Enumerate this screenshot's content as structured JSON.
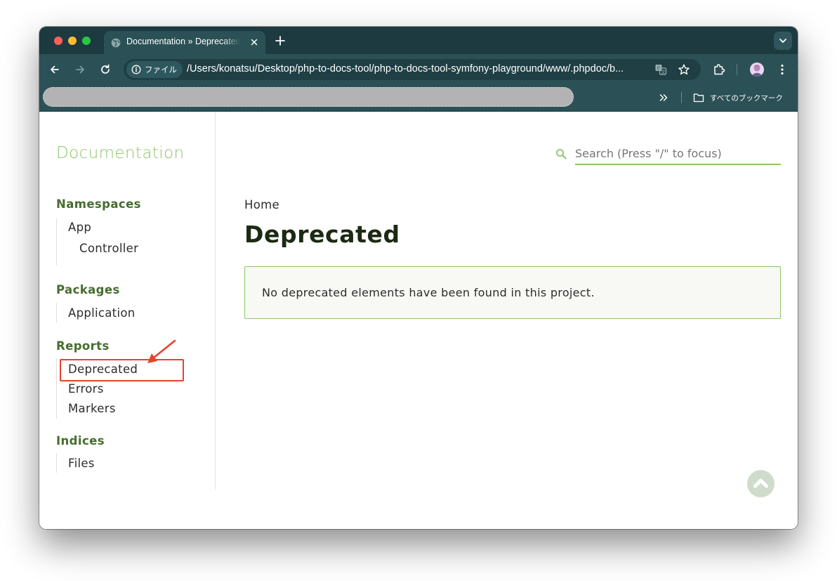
{
  "browser": {
    "tab": {
      "title": "Documentation » Deprecated",
      "favicon": "globe-icon"
    },
    "toolbar": {
      "chip_label": "ファイル",
      "url": "/Users/konatsu/Desktop/php-to-docs-tool/php-to-docs-tool-symfony-playground/www/.phpdoc/b..."
    },
    "bookmarks": {
      "folder_label": "すべてのブックマーク"
    }
  },
  "page": {
    "brand": "Documentation",
    "search_placeholder": "Search (Press \"/\" to focus)",
    "sidebar": {
      "namespaces": {
        "title": "Namespaces",
        "items": [
          "App",
          "Controller"
        ]
      },
      "packages": {
        "title": "Packages",
        "items": [
          "Application"
        ]
      },
      "reports": {
        "title": "Reports",
        "items": [
          "Deprecated",
          "Errors",
          "Markers"
        ]
      },
      "indices": {
        "title": "Indices",
        "items": [
          "Files"
        ]
      }
    },
    "breadcrumb": "Home",
    "title": "Deprecated",
    "notice": "No deprecated elements have been found in this project."
  },
  "colors": {
    "accent_green": "#8cc56b",
    "section_green": "#466d2e",
    "browser_frame": "#2b5157",
    "annotation_red": "#e8412b"
  }
}
